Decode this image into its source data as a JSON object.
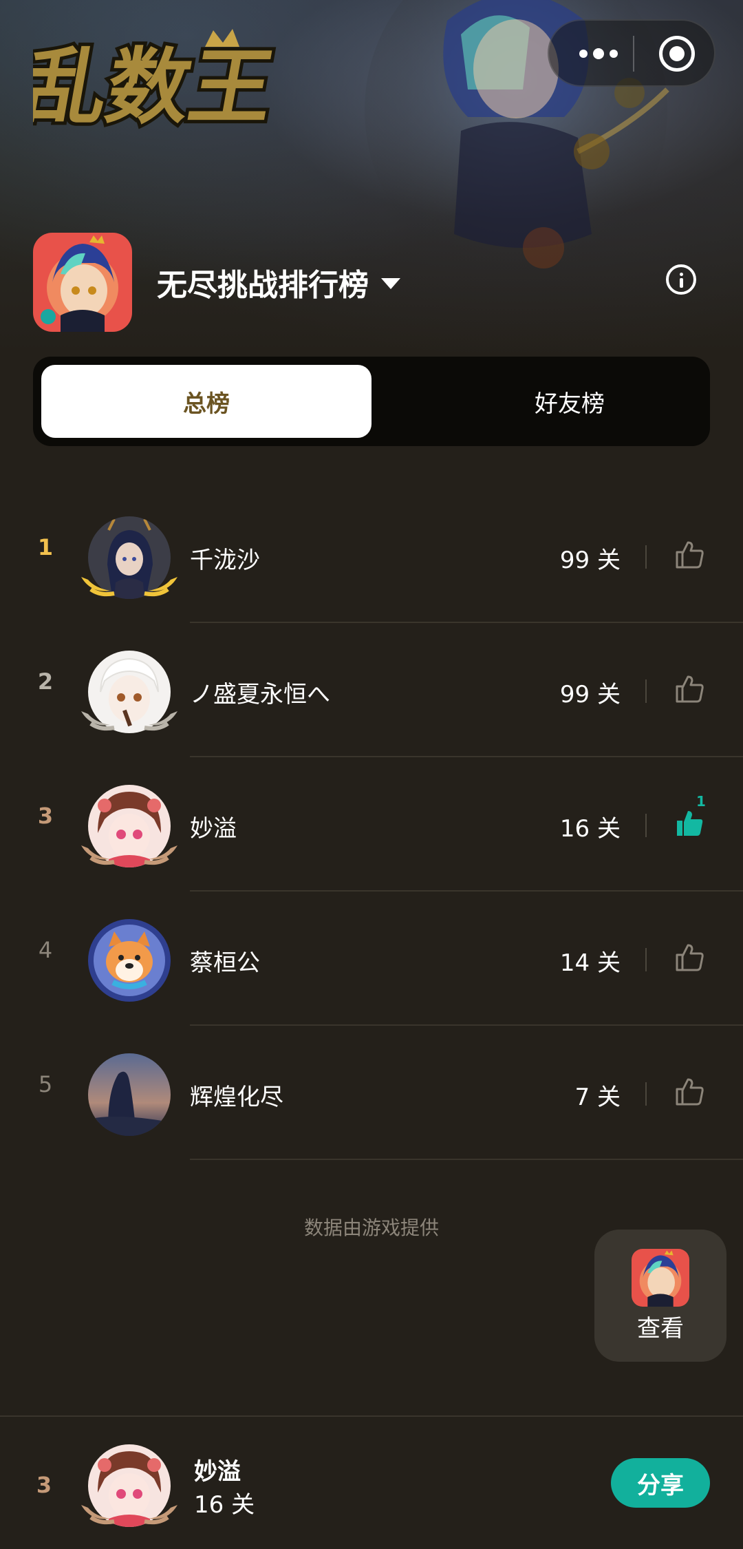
{
  "app": {
    "logo_text": "乱数王",
    "board_title": "无尽挑战排行榜"
  },
  "tabs": [
    {
      "label": "总榜",
      "active": true
    },
    {
      "label": "好友榜",
      "active": false
    }
  ],
  "colors": {
    "accent": "#12b09c",
    "rank1": "#f2c14e",
    "rank2": "#b9b4aa",
    "rank3": "#c59a78",
    "rank_default": "#8c857a",
    "background": "#24201a"
  },
  "ranking": [
    {
      "rank": "1",
      "name": "千泷沙",
      "score": "99 关",
      "liked": false,
      "like_count": ""
    },
    {
      "rank": "2",
      "name": "ノ盛夏永恒へ",
      "score": "99 关",
      "liked": false,
      "like_count": ""
    },
    {
      "rank": "3",
      "name": "妙溢",
      "score": "16 关",
      "liked": true,
      "like_count": "1"
    },
    {
      "rank": "4",
      "name": "蔡桓公",
      "score": "14 关",
      "liked": false,
      "like_count": ""
    },
    {
      "rank": "5",
      "name": "辉煌化尽",
      "score": "7 关",
      "liked": false,
      "like_count": ""
    }
  ],
  "footer_note": "数据由游戏提供",
  "float_button": {
    "label": "查看"
  },
  "me": {
    "rank": "3",
    "name": "妙溢",
    "score": "16 关",
    "share_label": "分享"
  }
}
